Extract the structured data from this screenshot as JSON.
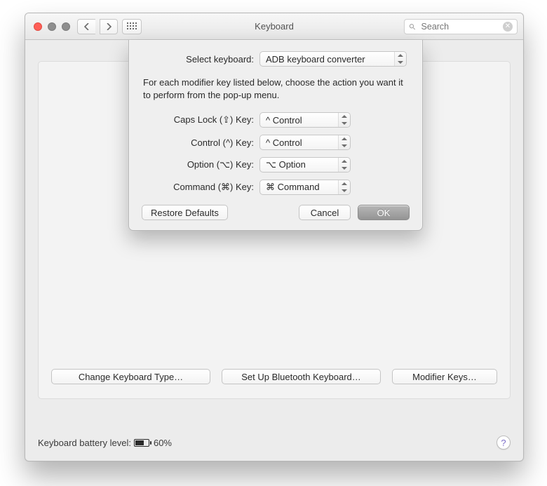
{
  "window": {
    "title": "Keyboard"
  },
  "toolbar": {
    "search_placeholder": "Search"
  },
  "panel": {
    "buttons": {
      "change_type": "Change Keyboard Type…",
      "bluetooth": "Set Up Bluetooth Keyboard…",
      "modifier_keys": "Modifier Keys…"
    }
  },
  "status": {
    "label": "Keyboard battery level:",
    "percent_text": "60%",
    "percent_value": 60
  },
  "sheet": {
    "select_keyboard_label": "Select keyboard:",
    "select_keyboard_value": "ADB keyboard converter",
    "description": "For each modifier key listed below, choose the action you want it to perform from the pop-up menu.",
    "rows": [
      {
        "label": "Caps Lock (⇪) Key:",
        "value": "^ Control"
      },
      {
        "label": "Control (^) Key:",
        "value": "^ Control"
      },
      {
        "label": "Option (⌥) Key:",
        "value": "⌥ Option"
      },
      {
        "label": "Command (⌘) Key:",
        "value": "⌘ Command"
      }
    ],
    "restore_defaults": "Restore Defaults",
    "cancel": "Cancel",
    "ok": "OK"
  }
}
